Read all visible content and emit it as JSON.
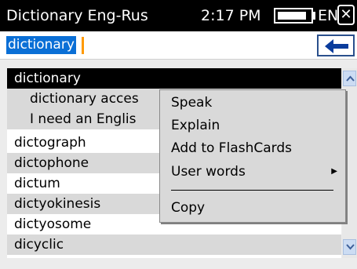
{
  "titlebar": {
    "app_title": "Dictionary Eng-Rus",
    "time": "2:17 PM",
    "battery_level": 0.9,
    "language": "EN",
    "close_glyph": "✕"
  },
  "search": {
    "value": "dictionary",
    "back_icon": "arrow-left-icon"
  },
  "word_list": [
    "dictionary",
    "dictionary acces",
    "I need an Englis",
    "dictograph",
    "dictophone",
    "dictum",
    "dictyokinesis",
    "dictyosome",
    "dicyclic"
  ],
  "selected_index": 0,
  "context_menu": {
    "items": [
      "Speak",
      "Explain",
      "Add to FlashCards",
      "User words",
      "Copy"
    ],
    "submenu_glyph": "▶"
  },
  "colors": {
    "selection": "#0a6fd6",
    "caret": "#ff9a00",
    "titlebar": "#000000",
    "row_alt": "#d9d9d9"
  }
}
